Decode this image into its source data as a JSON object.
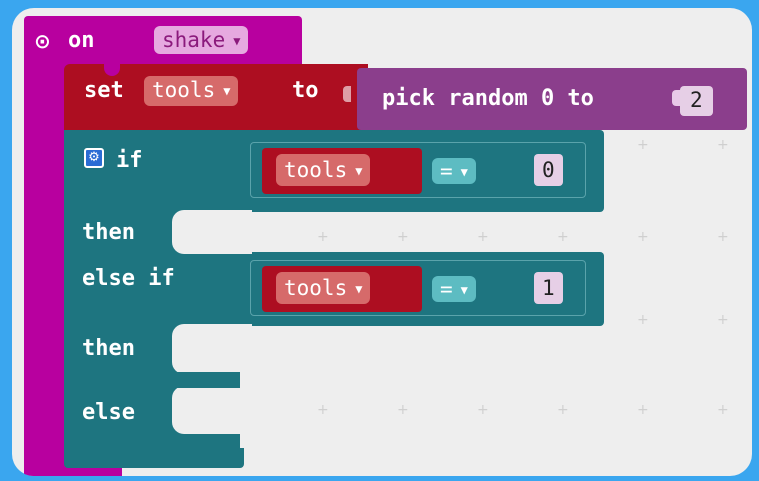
{
  "event": {
    "on_label": "on",
    "gesture": "shake"
  },
  "set_block": {
    "set_label": "set",
    "variable": "tools",
    "to_label": "to"
  },
  "random_block": {
    "label": "pick random 0 to",
    "max": "2"
  },
  "if_block": {
    "if_label": "if",
    "cond1": {
      "variable": "tools",
      "operator": "=",
      "value": "0"
    },
    "then1": "then",
    "else_if_label": "else if",
    "cond2": {
      "variable": "tools",
      "operator": "=",
      "value": "1"
    },
    "then2": "then",
    "else_label": "else"
  },
  "colors": {
    "event": "#b8009f",
    "set": "#ad0e21",
    "random": "#8b3e8c",
    "logic": "#1e7580",
    "variable_pill": "#d66a6a",
    "dropdown_pill": "#e6a9e0"
  }
}
